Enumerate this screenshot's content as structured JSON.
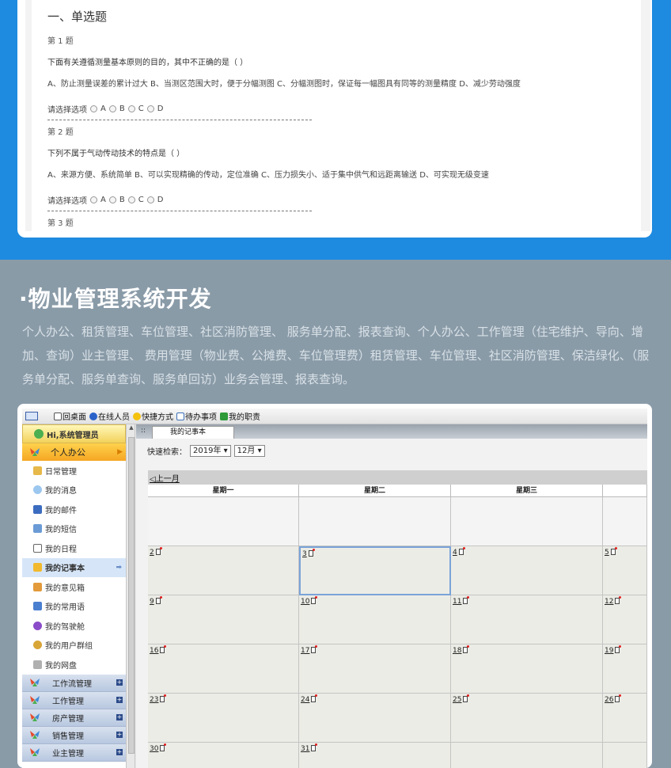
{
  "quiz": {
    "section_title": "一、单选题",
    "choose_label": "请选择选项",
    "questions": [
      {
        "num": "第 1 题",
        "text": "下面有关遵循测量基本原则的目的，其中不正确的是（ ）",
        "options": "A、防止测量误差的累计过大 B、当测区范围大时，便于分幅测图 C、分幅测图时，保证每一幅图具有同等的测量精度 D、减少劳动强度"
      },
      {
        "num": "第 2 题",
        "text": "下列不属于气动传动技术的特点是（ ）",
        "options": "A、来源方便、系统简单 B、可以实现精确的传动，定位准确 C、压力损失小、适于集中供气和远距离输送 D、可实现无级变速"
      },
      {
        "num": "第 3 题"
      }
    ],
    "choices": [
      "A",
      "B",
      "C",
      "D"
    ]
  },
  "section": {
    "title": "物业管理系统开发",
    "bullet": "·",
    "description": "个人办公、租赁管理、车位管理、社区消防管理、 服务单分配、报表查询、个人办公、工作管理（住宅维护、导向、增加、查询）业主管理、 费用管理（物业费、公摊费、车位管理费）租赁管理、车位管理、社区消防管理、保洁绿化、（服务单分配、服务单查询、服务单回访）业务会管理、报表查询。"
  },
  "app": {
    "toolbar": [
      "回桌面",
      "在线人员",
      "快捷方式",
      "待办事项",
      "我的职责"
    ],
    "greeting": "Hi,系统管理员",
    "sidebar_head": "个人办公",
    "sidebar_items": [
      "日常管理",
      "我的消息",
      "我的邮件",
      "我的短信",
      "我的日程",
      "我的记事本",
      "我的意见箱",
      "我的常用语",
      "我的驾驶舱",
      "我的用户群组",
      "我的网盘"
    ],
    "sidebar_groups": [
      "工作流管理",
      "工作管理",
      "房产管理",
      "销售管理",
      "业主管理"
    ],
    "tab_label": "我的记事本",
    "search_label": "快速检索：",
    "year": "2019年",
    "month": "12月",
    "prev_month": "上一月",
    "weekdays": [
      "星期一",
      "星期二",
      "星期三"
    ],
    "weeks": [
      [
        "",
        "",
        "",
        ""
      ],
      [
        "2",
        "3",
        "4",
        "5"
      ],
      [
        "9",
        "10",
        "11",
        "12"
      ],
      [
        "16",
        "17",
        "18",
        "19"
      ],
      [
        "23",
        "24",
        "25",
        "26"
      ],
      [
        "30",
        "31",
        "",
        ""
      ]
    ]
  },
  "colors": {
    "top_band": "#1e8be0",
    "lower_bg": "#8a9ba8",
    "accent": "#f5a623"
  }
}
